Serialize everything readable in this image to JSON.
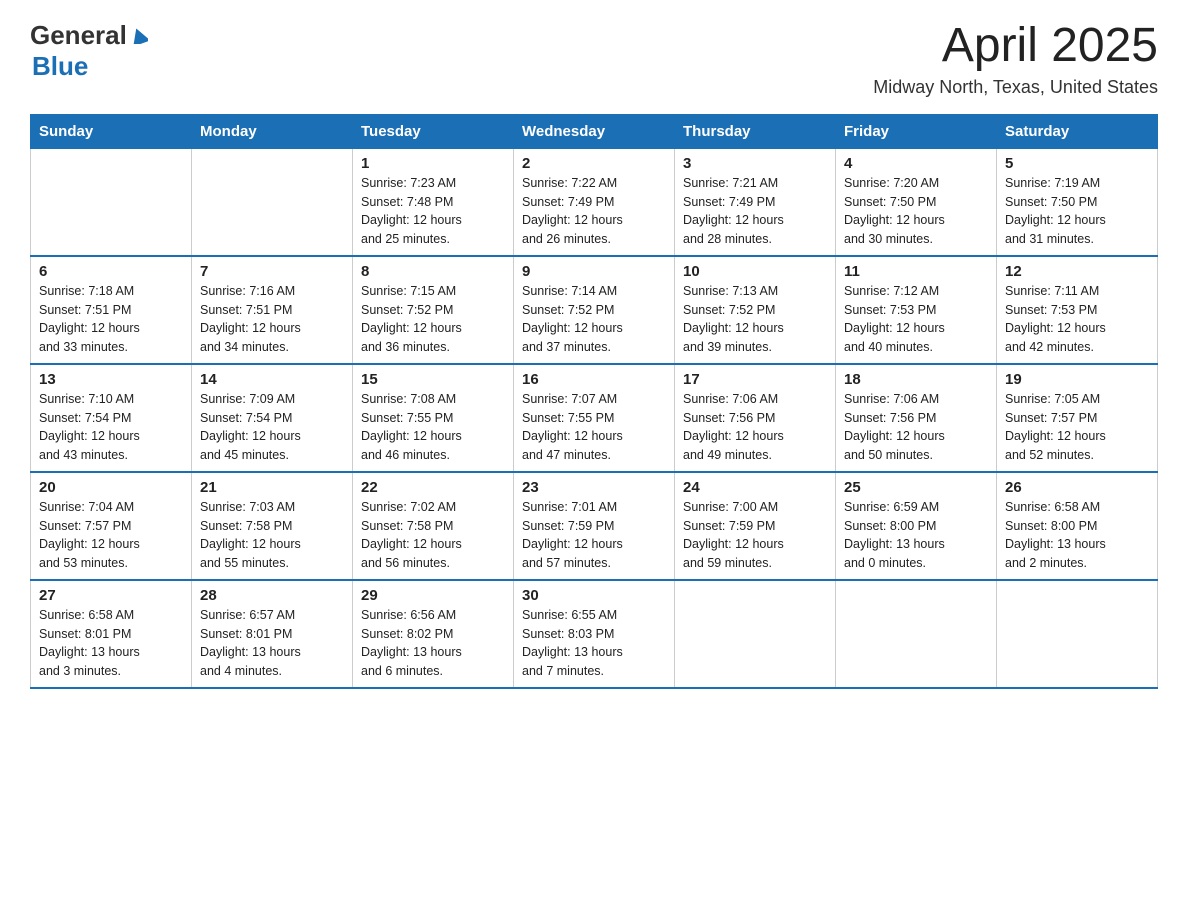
{
  "header": {
    "logo_general": "General",
    "logo_blue": "Blue",
    "month": "April 2025",
    "location": "Midway North, Texas, United States"
  },
  "weekdays": [
    "Sunday",
    "Monday",
    "Tuesday",
    "Wednesday",
    "Thursday",
    "Friday",
    "Saturday"
  ],
  "weeks": [
    [
      {
        "day": "",
        "info": ""
      },
      {
        "day": "",
        "info": ""
      },
      {
        "day": "1",
        "info": "Sunrise: 7:23 AM\nSunset: 7:48 PM\nDaylight: 12 hours\nand 25 minutes."
      },
      {
        "day": "2",
        "info": "Sunrise: 7:22 AM\nSunset: 7:49 PM\nDaylight: 12 hours\nand 26 minutes."
      },
      {
        "day": "3",
        "info": "Sunrise: 7:21 AM\nSunset: 7:49 PM\nDaylight: 12 hours\nand 28 minutes."
      },
      {
        "day": "4",
        "info": "Sunrise: 7:20 AM\nSunset: 7:50 PM\nDaylight: 12 hours\nand 30 minutes."
      },
      {
        "day": "5",
        "info": "Sunrise: 7:19 AM\nSunset: 7:50 PM\nDaylight: 12 hours\nand 31 minutes."
      }
    ],
    [
      {
        "day": "6",
        "info": "Sunrise: 7:18 AM\nSunset: 7:51 PM\nDaylight: 12 hours\nand 33 minutes."
      },
      {
        "day": "7",
        "info": "Sunrise: 7:16 AM\nSunset: 7:51 PM\nDaylight: 12 hours\nand 34 minutes."
      },
      {
        "day": "8",
        "info": "Sunrise: 7:15 AM\nSunset: 7:52 PM\nDaylight: 12 hours\nand 36 minutes."
      },
      {
        "day": "9",
        "info": "Sunrise: 7:14 AM\nSunset: 7:52 PM\nDaylight: 12 hours\nand 37 minutes."
      },
      {
        "day": "10",
        "info": "Sunrise: 7:13 AM\nSunset: 7:52 PM\nDaylight: 12 hours\nand 39 minutes."
      },
      {
        "day": "11",
        "info": "Sunrise: 7:12 AM\nSunset: 7:53 PM\nDaylight: 12 hours\nand 40 minutes."
      },
      {
        "day": "12",
        "info": "Sunrise: 7:11 AM\nSunset: 7:53 PM\nDaylight: 12 hours\nand 42 minutes."
      }
    ],
    [
      {
        "day": "13",
        "info": "Sunrise: 7:10 AM\nSunset: 7:54 PM\nDaylight: 12 hours\nand 43 minutes."
      },
      {
        "day": "14",
        "info": "Sunrise: 7:09 AM\nSunset: 7:54 PM\nDaylight: 12 hours\nand 45 minutes."
      },
      {
        "day": "15",
        "info": "Sunrise: 7:08 AM\nSunset: 7:55 PM\nDaylight: 12 hours\nand 46 minutes."
      },
      {
        "day": "16",
        "info": "Sunrise: 7:07 AM\nSunset: 7:55 PM\nDaylight: 12 hours\nand 47 minutes."
      },
      {
        "day": "17",
        "info": "Sunrise: 7:06 AM\nSunset: 7:56 PM\nDaylight: 12 hours\nand 49 minutes."
      },
      {
        "day": "18",
        "info": "Sunrise: 7:06 AM\nSunset: 7:56 PM\nDaylight: 12 hours\nand 50 minutes."
      },
      {
        "day": "19",
        "info": "Sunrise: 7:05 AM\nSunset: 7:57 PM\nDaylight: 12 hours\nand 52 minutes."
      }
    ],
    [
      {
        "day": "20",
        "info": "Sunrise: 7:04 AM\nSunset: 7:57 PM\nDaylight: 12 hours\nand 53 minutes."
      },
      {
        "day": "21",
        "info": "Sunrise: 7:03 AM\nSunset: 7:58 PM\nDaylight: 12 hours\nand 55 minutes."
      },
      {
        "day": "22",
        "info": "Sunrise: 7:02 AM\nSunset: 7:58 PM\nDaylight: 12 hours\nand 56 minutes."
      },
      {
        "day": "23",
        "info": "Sunrise: 7:01 AM\nSunset: 7:59 PM\nDaylight: 12 hours\nand 57 minutes."
      },
      {
        "day": "24",
        "info": "Sunrise: 7:00 AM\nSunset: 7:59 PM\nDaylight: 12 hours\nand 59 minutes."
      },
      {
        "day": "25",
        "info": "Sunrise: 6:59 AM\nSunset: 8:00 PM\nDaylight: 13 hours\nand 0 minutes."
      },
      {
        "day": "26",
        "info": "Sunrise: 6:58 AM\nSunset: 8:00 PM\nDaylight: 13 hours\nand 2 minutes."
      }
    ],
    [
      {
        "day": "27",
        "info": "Sunrise: 6:58 AM\nSunset: 8:01 PM\nDaylight: 13 hours\nand 3 minutes."
      },
      {
        "day": "28",
        "info": "Sunrise: 6:57 AM\nSunset: 8:01 PM\nDaylight: 13 hours\nand 4 minutes."
      },
      {
        "day": "29",
        "info": "Sunrise: 6:56 AM\nSunset: 8:02 PM\nDaylight: 13 hours\nand 6 minutes."
      },
      {
        "day": "30",
        "info": "Sunrise: 6:55 AM\nSunset: 8:03 PM\nDaylight: 13 hours\nand 7 minutes."
      },
      {
        "day": "",
        "info": ""
      },
      {
        "day": "",
        "info": ""
      },
      {
        "day": "",
        "info": ""
      }
    ]
  ]
}
